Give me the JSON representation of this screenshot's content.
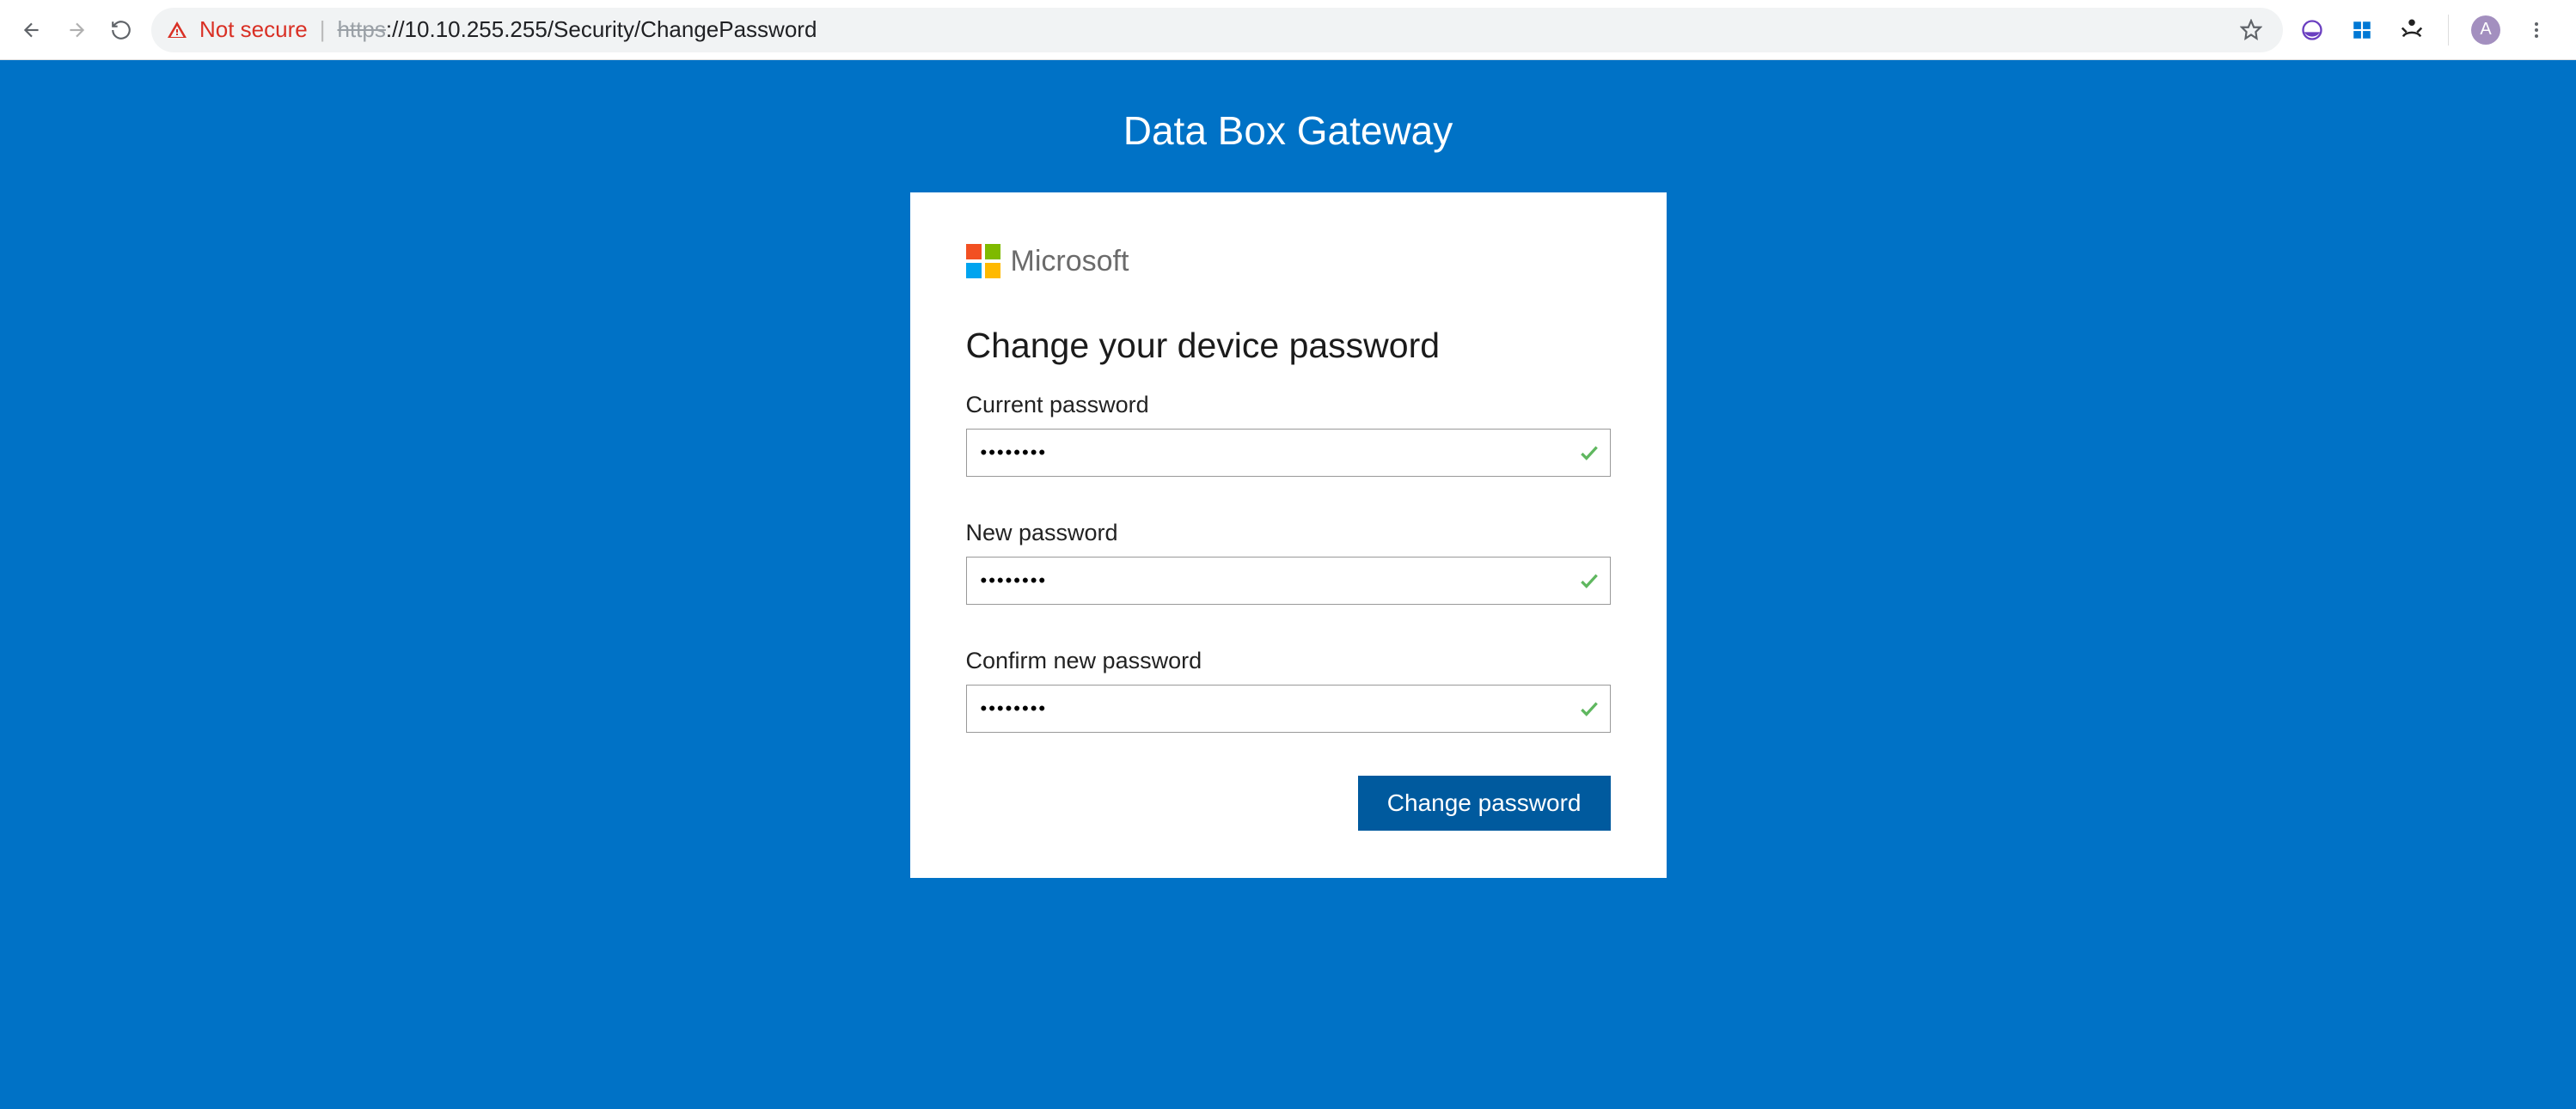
{
  "browser": {
    "not_secure": "Not secure",
    "url_https": "https",
    "url_rest": "://10.10.255.255/Security/ChangePassword",
    "avatar_initial": "A"
  },
  "page": {
    "title": "Data Box Gateway",
    "brand": "Microsoft",
    "heading": "Change your device password",
    "fields": {
      "current": {
        "label": "Current password",
        "value": "••••••••"
      },
      "new": {
        "label": "New password",
        "value": "••••••••"
      },
      "confirm": {
        "label": "Confirm new password",
        "value": "••••••••"
      }
    },
    "submit": "Change password"
  }
}
